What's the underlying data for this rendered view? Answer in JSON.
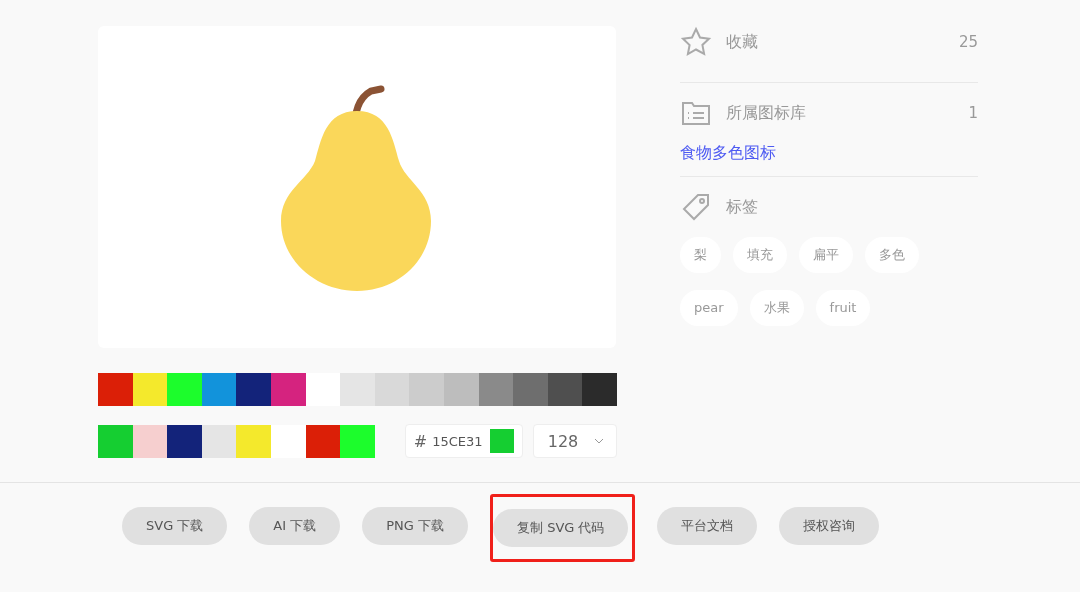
{
  "palette": [
    {
      "color": "#db1f07"
    },
    {
      "color": "#f4e92c"
    },
    {
      "color": "#1cfd2c"
    },
    {
      "color": "#1293db"
    },
    {
      "color": "#13237a"
    },
    {
      "color": "#d5237f"
    },
    {
      "color": "#ffffff"
    },
    {
      "color": "#e5e5e5"
    },
    {
      "color": "#d9d9d9"
    },
    {
      "color": "#cccccc"
    },
    {
      "color": "#bdbdbd"
    },
    {
      "color": "#8a8a8a"
    },
    {
      "color": "#6e6e6e"
    },
    {
      "color": "#4f4f4f"
    },
    {
      "color": "#2b2b2b"
    }
  ],
  "used_colors": [
    {
      "color": "#15ce31"
    },
    {
      "color": "#f6cfcf"
    },
    {
      "color": "#13237a"
    },
    {
      "color": "#e5e5e5"
    },
    {
      "color": "#f4e92c"
    },
    {
      "color": "#ffffff"
    },
    {
      "color": "#db1f07"
    },
    {
      "color": "#1cfd2c"
    }
  ],
  "color_field": {
    "prefix": "#",
    "value": "15CE31",
    "color": "#15ce31"
  },
  "size_select": {
    "value": "128"
  },
  "stats": [
    {
      "kind": "favorite",
      "label": "收藏",
      "count": "25"
    },
    {
      "kind": "library",
      "label": "所属图标库",
      "count": "1",
      "link": "食物多色图标"
    }
  ],
  "tags_title": "标签",
  "tags": [
    "梨",
    "填充",
    "扁平",
    "多色",
    "pear",
    "水果",
    "fruit"
  ],
  "buttons": [
    {
      "label": "SVG 下载",
      "highlighted": false
    },
    {
      "label": "AI 下载",
      "highlighted": false
    },
    {
      "label": "PNG 下载",
      "highlighted": false
    },
    {
      "label": "复制 SVG 代码",
      "highlighted": true
    },
    {
      "label": "平台文档",
      "highlighted": false
    },
    {
      "label": "授权咨询",
      "highlighted": false
    }
  ]
}
